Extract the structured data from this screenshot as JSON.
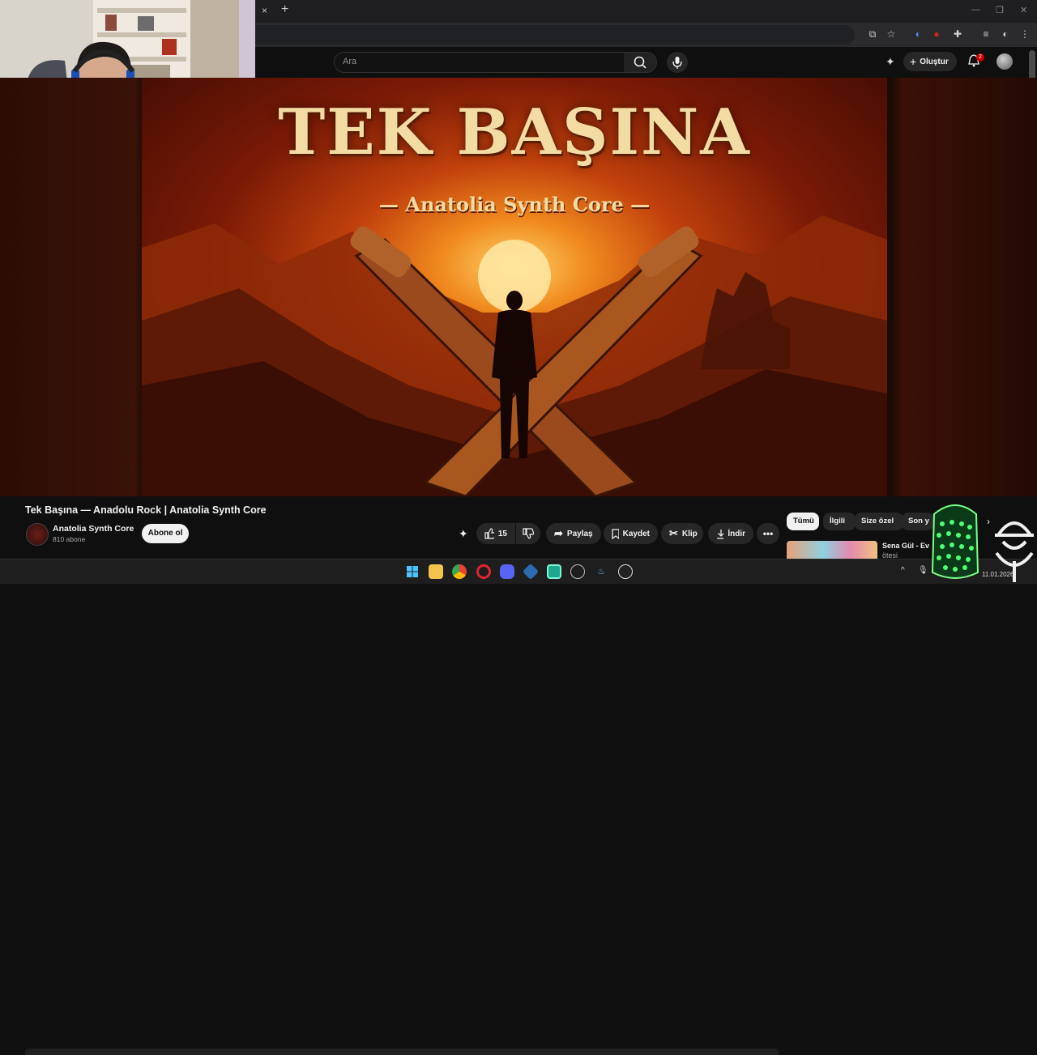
{
  "browser": {
    "tab_close": "×",
    "new_tab": "+",
    "window_controls": [
      "—",
      "❐",
      "✕"
    ]
  },
  "header": {
    "search_placeholder": "Ara",
    "create_label": "Oluştur",
    "notification_count": "2"
  },
  "artwork": {
    "title": "TEK BAŞINA",
    "subtitle": "— Anatolia Synth Core —"
  },
  "video": {
    "title": "Tek Başına — Anadolu Rock | Anatolia Synth Core",
    "channel_name": "Anatolia Synth Core",
    "subscriber_count": "810 abone",
    "subscribe_label": "Abone ol",
    "like_count": "15",
    "share_label": "Paylaş",
    "save_label": "Kaydet",
    "clip_label": "Klip",
    "download_label": "İndir"
  },
  "chips": [
    {
      "label": "Tümü"
    },
    {
      "label": "İlgili"
    },
    {
      "label": "Size özel"
    },
    {
      "label": "Son y"
    }
  ],
  "recommendation": {
    "title": "Sena Gül - Ev",
    "subtitle": "ötesi"
  },
  "taskbar": {
    "clock": "11.01.2026"
  },
  "colors": {
    "accent_red": "#cc0000",
    "page_bg": "#0f0f0f",
    "chip_bg": "#272727"
  }
}
